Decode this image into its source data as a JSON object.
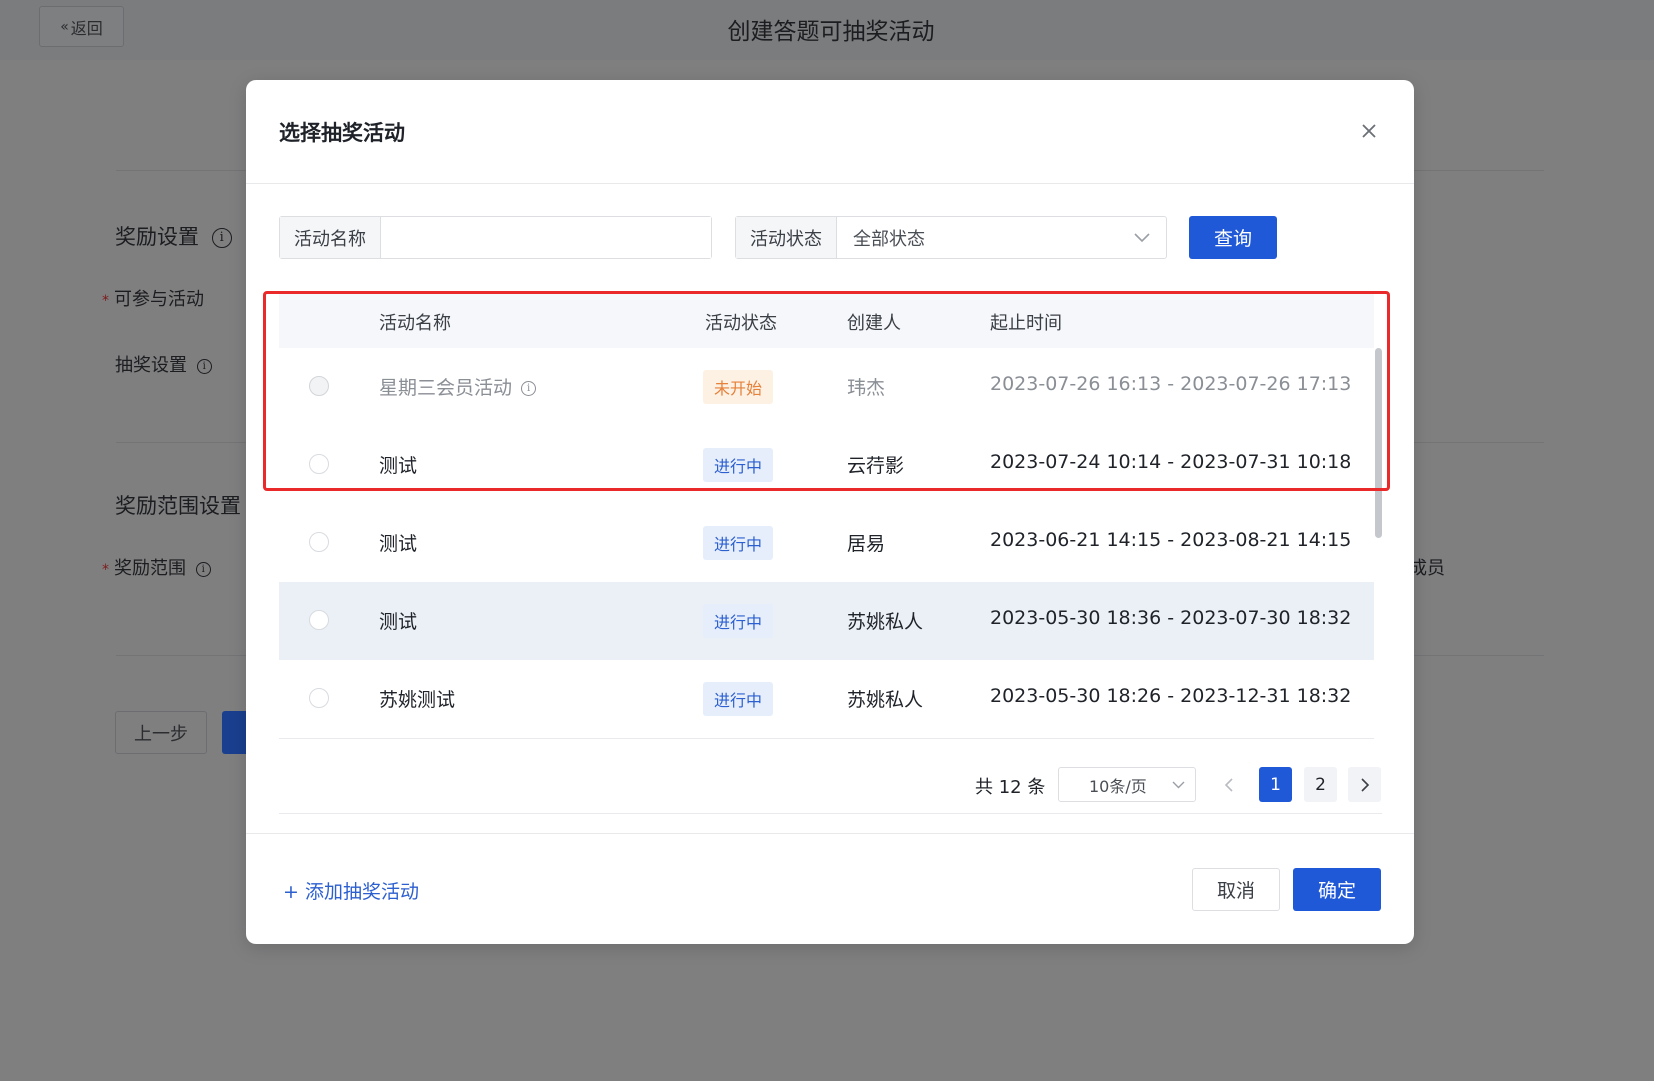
{
  "page": {
    "back_label": "返回",
    "title": "创建答题可抽奖活动",
    "sections": {
      "reward_settings": "奖励设置",
      "participating_activity": "可参与活动",
      "lottery_settings": "抽奖设置",
      "reward_scope_settings": "奖励范围设置",
      "reward_scope": "奖励范围",
      "scope_trailing": "成员"
    },
    "prev_step": "上一步"
  },
  "modal": {
    "title": "选择抽奖活动",
    "filters": {
      "name_label": "活动名称",
      "name_value": "",
      "status_label": "活动状态",
      "status_value": "全部状态",
      "query_button": "查询"
    },
    "table": {
      "columns": [
        "活动名称",
        "活动状态",
        "创建人",
        "起止时间"
      ],
      "rows": [
        {
          "name": "星期三会员活动",
          "status": "未开始",
          "creator": "玮杰",
          "time": "2023-07-26 16:13 - 2023-07-26 17:13",
          "disabled": true
        },
        {
          "name": "测试",
          "status": "进行中",
          "creator": "云荇影",
          "time": "2023-07-24 10:14 - 2023-07-31 10:18",
          "disabled": false
        },
        {
          "name": "测试",
          "status": "进行中",
          "creator": "居易",
          "time": "2023-06-21 14:15 - 2023-08-21 14:15",
          "disabled": false
        },
        {
          "name": "测试",
          "status": "进行中",
          "creator": "苏姚私人",
          "time": "2023-05-30 18:36 - 2023-07-30 18:32",
          "disabled": false
        },
        {
          "name": "苏姚测试",
          "status": "进行中",
          "creator": "苏姚私人",
          "time": "2023-05-30 18:26 - 2023-12-31 18:32",
          "disabled": false
        }
      ]
    },
    "pagination": {
      "total": "共 12 条",
      "page_size": "10条/页",
      "pages": [
        "1",
        "2"
      ],
      "current_page": "1"
    },
    "add_link": "+ 添加抽奖活动",
    "cancel_button": "取消",
    "confirm_button": "确定"
  },
  "colors": {
    "primary": "#2059d8",
    "highlight_box": "#ea2a2a",
    "not_started": "#e5813a",
    "running": "#2c5fcf"
  }
}
